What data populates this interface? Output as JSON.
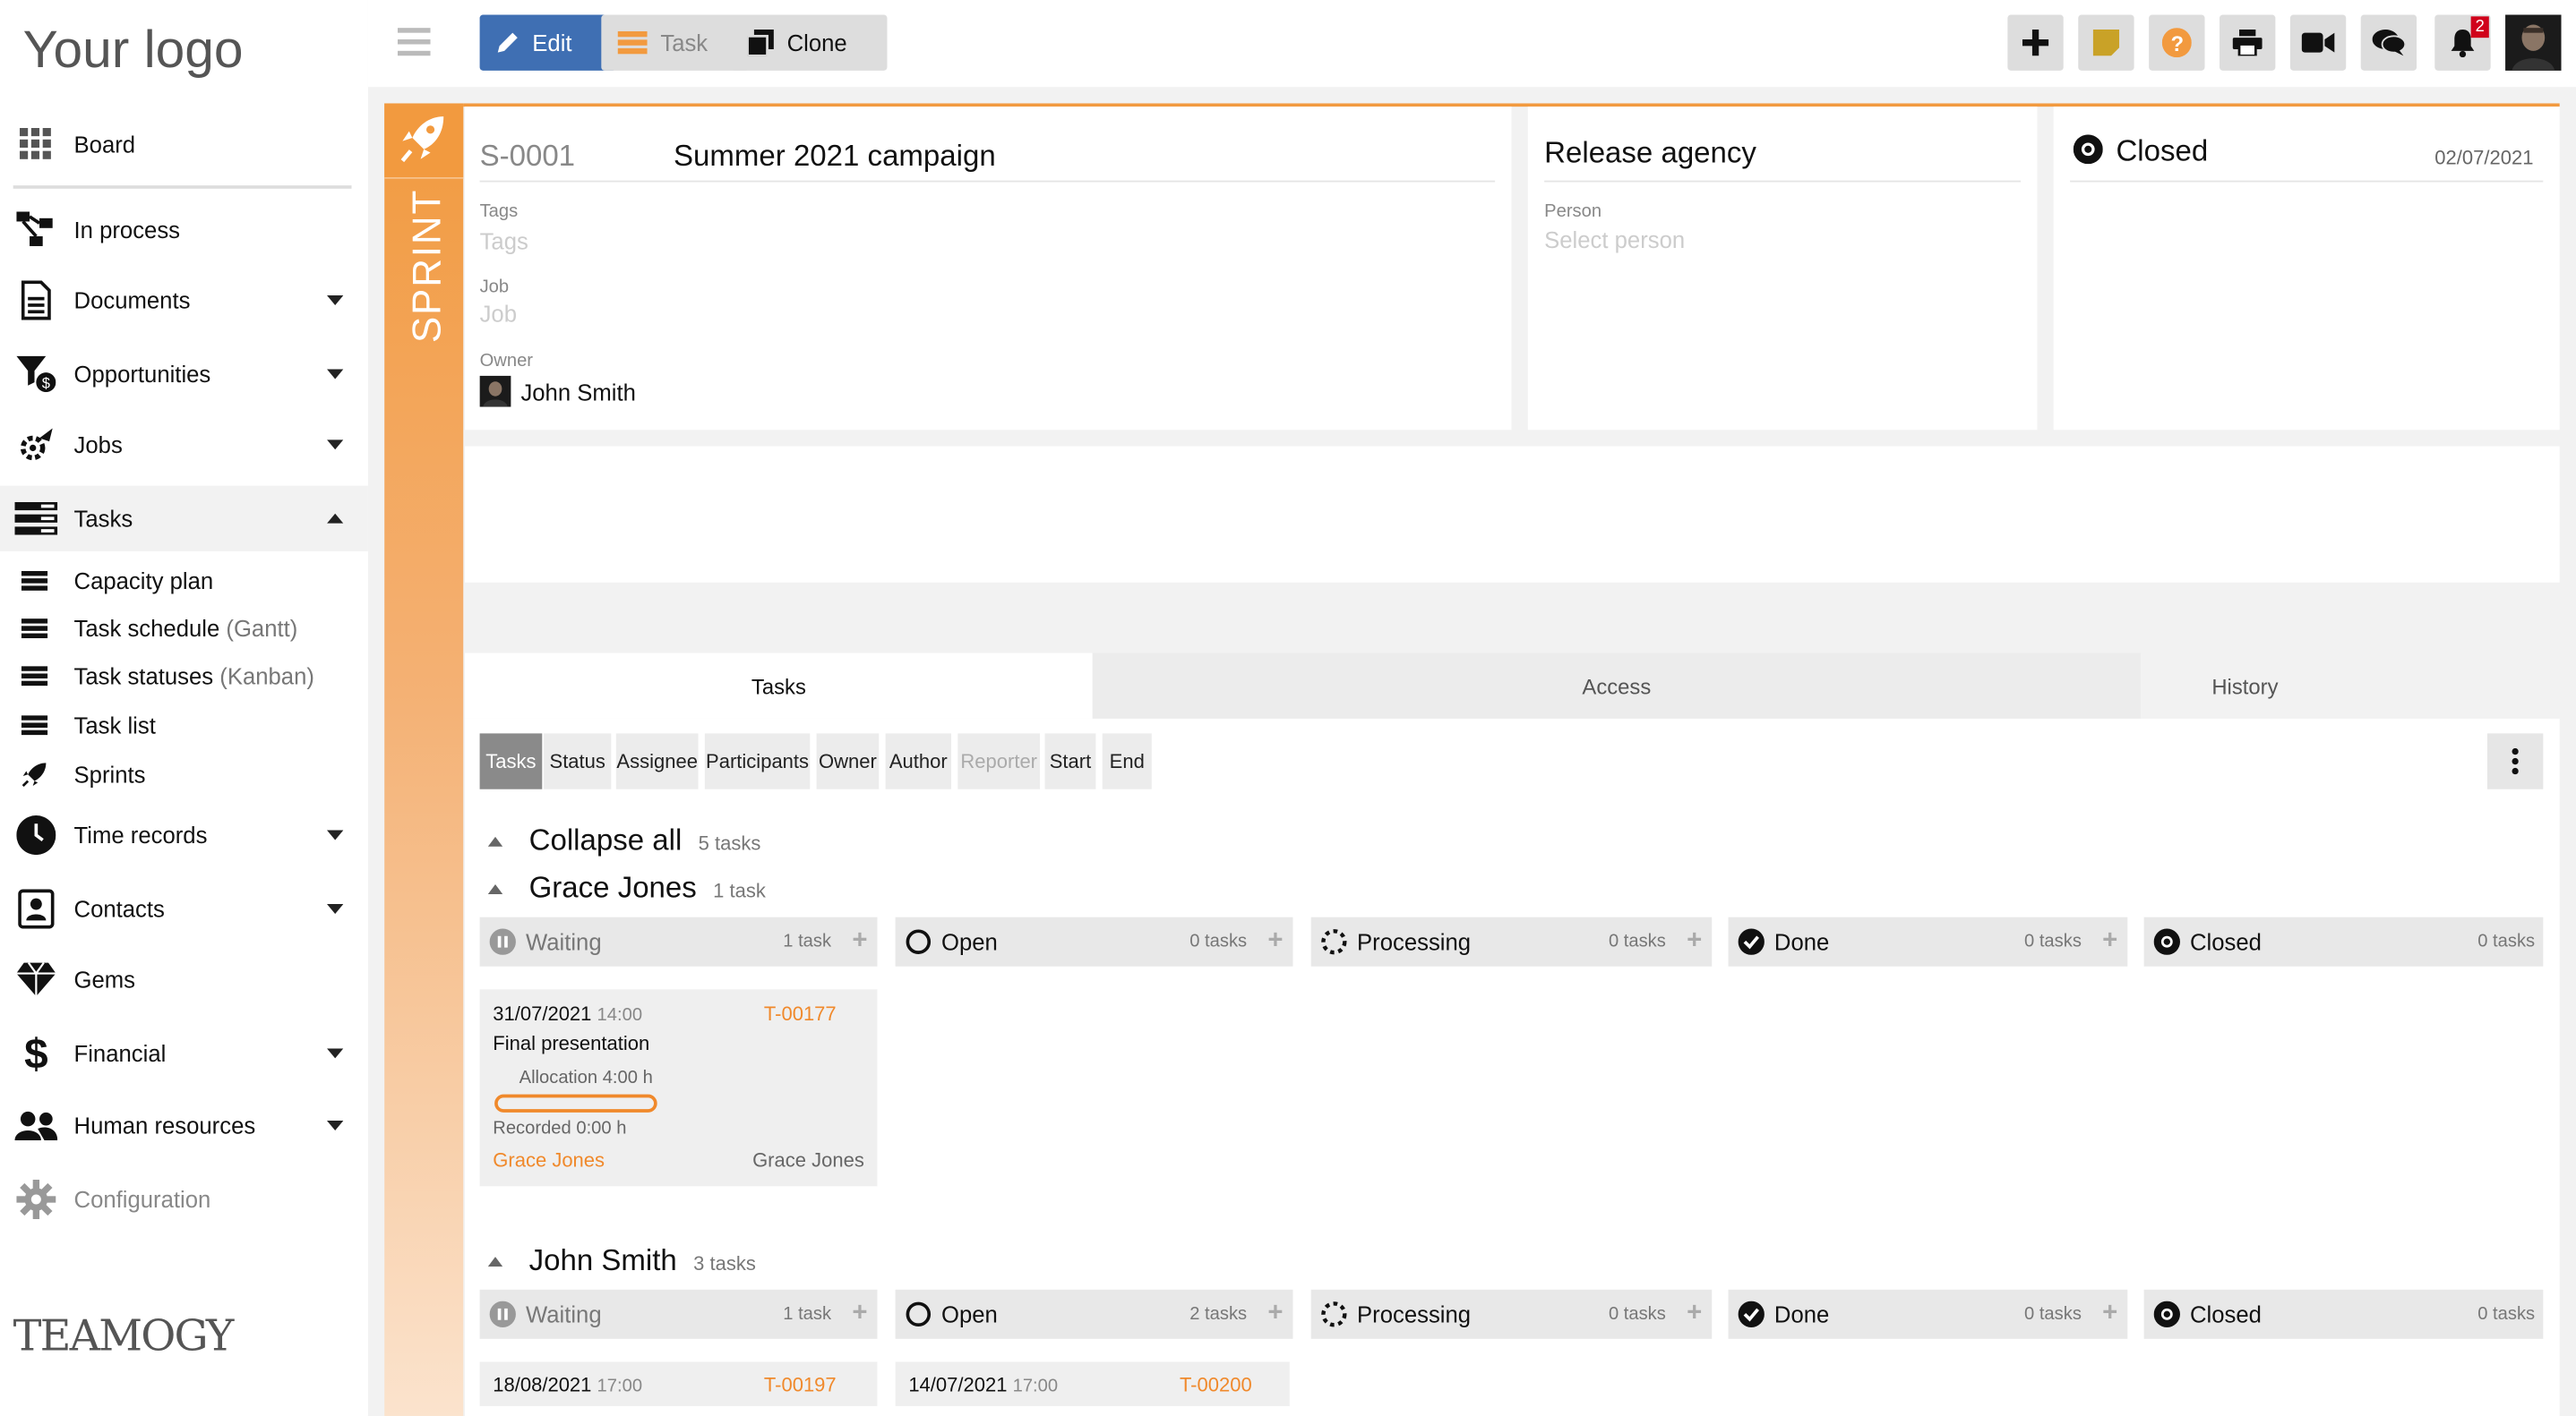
{
  "sidebar": {
    "logo": "Your logo",
    "items": [
      {
        "label": "Board"
      },
      {
        "label": "In process"
      },
      {
        "label": "Documents"
      },
      {
        "label": "Opportunities"
      },
      {
        "label": "Jobs"
      },
      {
        "label": "Tasks"
      },
      {
        "label": "Time records"
      },
      {
        "label": "Contacts"
      },
      {
        "label": "Gems"
      },
      {
        "label": "Financial"
      },
      {
        "label": "Human resources"
      },
      {
        "label": "Configuration"
      }
    ],
    "task_sub": [
      {
        "label": "Capacity plan",
        "muted": ""
      },
      {
        "label": "Task schedule",
        "muted": "(Gantt)"
      },
      {
        "label": "Task statuses",
        "muted": "(Kanban)"
      },
      {
        "label": "Task list",
        "muted": ""
      },
      {
        "label": "Sprints",
        "muted": ""
      }
    ],
    "footer_logo": "TEAMOGY"
  },
  "toolbar": {
    "edit": "Edit",
    "task": "Task",
    "clone": "Clone",
    "notification_count": "2"
  },
  "sprint": {
    "side_label": "SPRINT",
    "id": "S-0001",
    "name": "Summer 2021 campaign",
    "tags_label": "Tags",
    "tags_placeholder": "Tags",
    "job_label": "Job",
    "job_placeholder": "Job",
    "owner_label": "Owner",
    "owner": "John Smith"
  },
  "agency": {
    "title": "Release agency",
    "person_label": "Person",
    "person_placeholder": "Select person"
  },
  "state": {
    "status": "Closed",
    "date": "02/07/2021"
  },
  "tabs": [
    {
      "label": "Tasks"
    },
    {
      "label": "Access"
    },
    {
      "label": "History"
    }
  ],
  "crumbs": [
    "Tasks",
    "Status",
    "Assignee",
    "Participants",
    "Owner",
    "Author",
    "Reporter",
    "Start",
    "End"
  ],
  "kanban": {
    "collapse_all": "Collapse all",
    "total": "5 tasks",
    "groups": [
      {
        "name": "Grace Jones",
        "count": "1 task",
        "columns": [
          {
            "name": "Waiting",
            "count": "1 task"
          },
          {
            "name": "Open",
            "count": "0 tasks"
          },
          {
            "name": "Processing",
            "count": "0 tasks"
          },
          {
            "name": "Done",
            "count": "0 tasks"
          },
          {
            "name": "Closed",
            "count": "0 tasks"
          }
        ],
        "cards": [
          {
            "date": "31/07/2021",
            "time": "14:00",
            "id": "T-00177",
            "title": "Final presentation",
            "allocation": "Allocation 4:00 h",
            "recorded": "Recorded 0:00 h",
            "assignee": "Grace Jones",
            "owner": "Grace Jones"
          }
        ]
      },
      {
        "name": "John Smith",
        "count": "3 tasks",
        "columns": [
          {
            "name": "Waiting",
            "count": "1 task"
          },
          {
            "name": "Open",
            "count": "2 tasks"
          },
          {
            "name": "Processing",
            "count": "0 tasks"
          },
          {
            "name": "Done",
            "count": "0 tasks"
          },
          {
            "name": "Closed",
            "count": "0 tasks"
          }
        ],
        "cards": [
          {
            "date": "18/08/2021",
            "time": "17:00",
            "id": "T-00197"
          },
          {
            "date": "14/07/2021",
            "time": "17:00",
            "id": "T-00200"
          }
        ]
      }
    ]
  },
  "colors": {
    "accent": "#f29a3f",
    "edit_button": "#3f6fb3",
    "badge": "#d0021b"
  }
}
